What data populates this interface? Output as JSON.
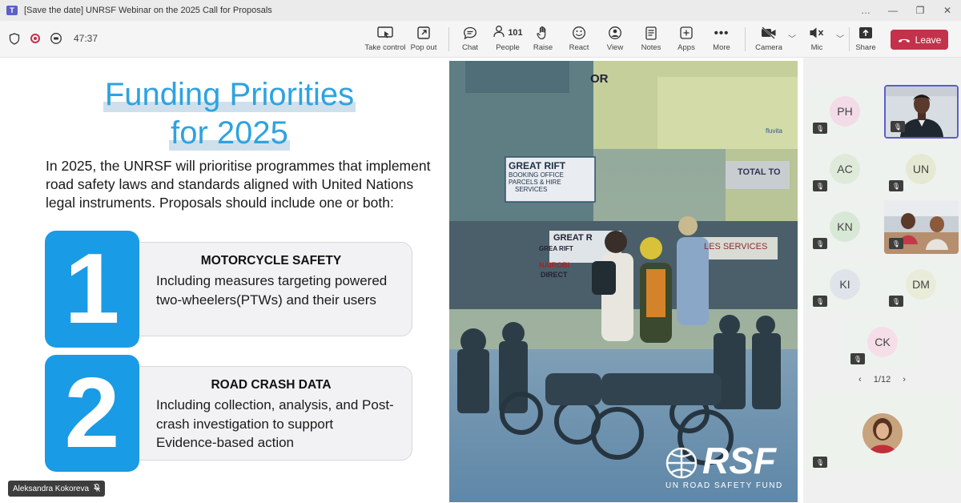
{
  "window": {
    "title": "[Save the date] UNRSF Webinar on the 2025 Call for Proposals",
    "controls": [
      "…",
      "—",
      "❐",
      "✕"
    ]
  },
  "meeting": {
    "timer": "47:37"
  },
  "toolbar": {
    "take_control": "Take control",
    "pop_out": "Pop out",
    "chat": "Chat",
    "people": "People",
    "people_count": "101",
    "raise": "Raise",
    "react": "React",
    "view": "View",
    "notes": "Notes",
    "apps": "Apps",
    "more": "More",
    "camera": "Camera",
    "mic": "Mic",
    "share": "Share",
    "leave": "Leave"
  },
  "slide": {
    "title_line1": "Funding Priorities",
    "title_line2": "for 2025",
    "intro": "In 2025, the UNRSF will prioritise programmes that implement road safety laws and standards aligned with United Nations legal instruments. Proposals should include one or both:",
    "items": [
      {
        "number": "1",
        "title": "MOTORCYCLE SAFETY",
        "body": "Including measures targeting powered two-wheelers(PTWs) and their users"
      },
      {
        "number": "2",
        "title": "ROAD CRASH DATA",
        "body": "Including collection, analysis, and Post-crash investigation to support Evidence-based action"
      }
    ],
    "photo": {
      "sign_top": "OR",
      "sign_great_rift": "GREAT RIFT",
      "sign_booking": "BOOKING OFFICE",
      "sign_parcels": "PARCELS & HIRE",
      "sign_services": "SERVICES",
      "sign_great_rift_2": "GREAT R",
      "sign_great_rift_3": "GREA RIFT",
      "sign_nairobi": "NAIROBI",
      "sign_direct": "DIRECT",
      "sign_les_services": "LES SERVICES",
      "sign_total_to": "TOTAL TO",
      "sign_social": "fluvita",
      "logo_main": "RSF",
      "logo_sub": "UN ROAD SAFETY FUND"
    }
  },
  "presenter": {
    "name": "Aleksandra Kokoreva"
  },
  "participants": [
    {
      "initials": "PH",
      "color": "#f3dbe8"
    },
    {
      "initials": "AC",
      "color": "#dfeadb"
    },
    {
      "initials": "UN",
      "color": "#e5e9d3"
    },
    {
      "initials": "KN",
      "color": "#d8e8d6"
    },
    {
      "initials": "KI",
      "color": "#dfe4ea"
    },
    {
      "initials": "DM",
      "color": "#e9ecd8"
    },
    {
      "initials": "CK",
      "color": "#f5dee8"
    }
  ],
  "pager": {
    "label": "1/12"
  },
  "colors": {
    "accent_blue": "#1a9be6",
    "title_blue": "#2ea3e0",
    "leave_red": "#c4314b",
    "selected_tile": "#5b5fc7"
  }
}
